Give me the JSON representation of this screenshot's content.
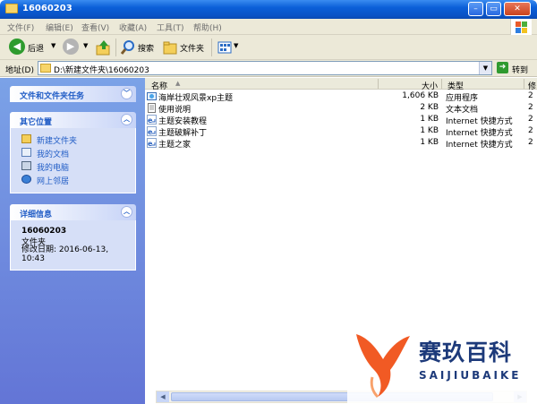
{
  "window": {
    "title": "16060203",
    "minimize_label": "0",
    "maximize_label": "1",
    "close_label": "r"
  },
  "menu": [
    "文件(F)",
    "编辑(E)",
    "查看(V)",
    "收藏(A)",
    "工具(T)",
    "帮助(H)"
  ],
  "toolbar": {
    "back_label": "后退",
    "search_label": "搜索",
    "folders_label": "文件夹"
  },
  "address": {
    "label": "地址(D)",
    "path": "D:\\新建文件夹\\16060203",
    "go_label": "转到"
  },
  "tasks": {
    "file_tasks_title": "文件和文件夹任务",
    "other_places_title": "其它位置",
    "other_places": [
      {
        "label": "新建文件夹",
        "icon": "folder-icon"
      },
      {
        "label": "我的文档",
        "icon": "my-documents-icon"
      },
      {
        "label": "我的电脑",
        "icon": "my-computer-icon"
      },
      {
        "label": "网上邻居",
        "icon": "network-icon"
      }
    ],
    "details_title": "详细信息",
    "details": {
      "name": "16060203",
      "type": "文件夹",
      "modified": "修改日期: 2016-06-13, 10:43"
    }
  },
  "columns": {
    "name": "名称",
    "size": "大小",
    "type": "类型",
    "date": "修"
  },
  "files": [
    {
      "name": "海岸壮观风景xp主题",
      "size": "1,606 KB",
      "type": "应用程序",
      "date": "2",
      "icon": "application-icon"
    },
    {
      "name": "使用说明",
      "size": "2 KB",
      "type": "文本文档",
      "date": "2",
      "icon": "text-document-icon"
    },
    {
      "name": "主题安装教程",
      "size": "1 KB",
      "type": "Internet 快捷方式",
      "date": "2",
      "icon": "internet-shortcut-icon"
    },
    {
      "name": "主题破解补丁",
      "size": "1 KB",
      "type": "Internet 快捷方式",
      "date": "2",
      "icon": "internet-shortcut-icon"
    },
    {
      "name": "主题之家",
      "size": "1 KB",
      "type": "Internet 快捷方式",
      "date": "2",
      "icon": "internet-shortcut-icon"
    }
  ],
  "watermark": {
    "cn": "赛玖百科",
    "en": "SAIJIUBAIKE"
  },
  "colors": {
    "titlebar": "#0b5fd8",
    "task_pane": "#6f8fe0",
    "task_link": "#215dc6",
    "watermark_orange": "#f15a24",
    "watermark_navy": "#1d3a7a"
  }
}
